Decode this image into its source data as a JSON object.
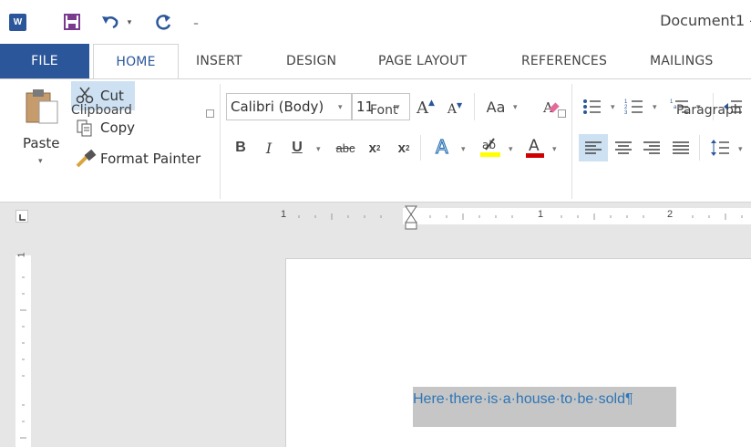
{
  "window": {
    "title": "Document1 -"
  },
  "tabs": [
    "FILE",
    "HOME",
    "INSERT",
    "DESIGN",
    "PAGE LAYOUT",
    "REFERENCES",
    "MAILINGS"
  ],
  "clipboard": {
    "paste_label": "Paste",
    "cut_label": "Cut",
    "copy_label": "Copy",
    "format_painter_label": "Format Painter",
    "group_label": "Clipboard"
  },
  "font": {
    "font_name": "Calibri (Body)",
    "font_size": "11",
    "change_case_label": "Aa",
    "bold": "B",
    "italic": "I",
    "underline": "U",
    "strike": "abc",
    "subscript_label": "x",
    "subscript_mark": "2",
    "superscript_label": "x",
    "superscript_mark": "2",
    "group_label": "Font"
  },
  "paragraph": {
    "group_label": "Paragraph"
  },
  "ruler": {
    "mark_left": "1",
    "mark_mid": "1",
    "mark_right": "2",
    "v_mark": "1"
  },
  "document": {
    "text": "Here·there·is·a·house·to·be·sold¶"
  },
  "colors": {
    "accent": "#2b579a",
    "highlight": "#cde1f3",
    "text_blue": "#2e75b6",
    "highlighter_yellow": "#ffff00",
    "font_color_red": "#d00000"
  }
}
